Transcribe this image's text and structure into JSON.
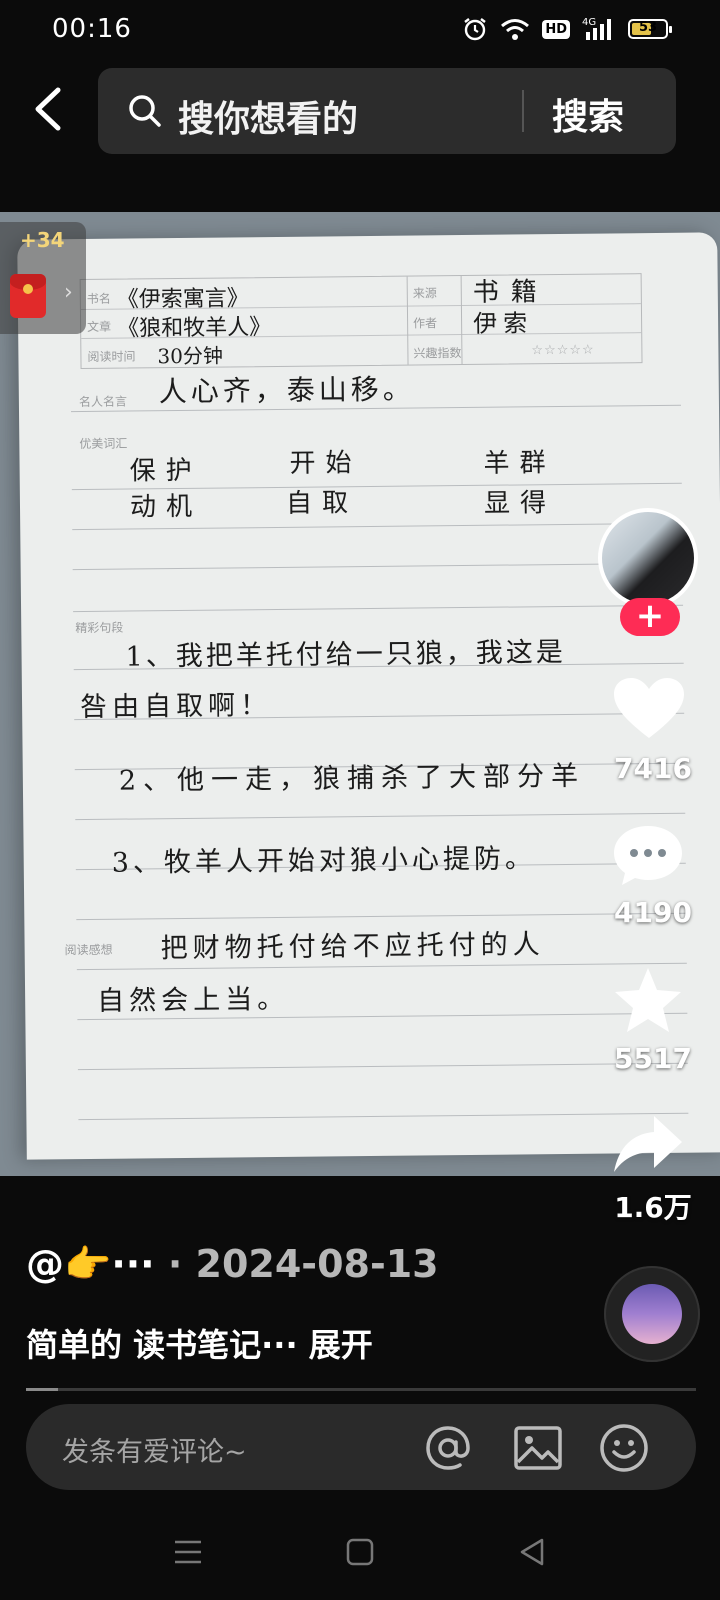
{
  "status_bar": {
    "time": "00:16",
    "network": "4G",
    "hd": "HD",
    "battery": "53"
  },
  "search": {
    "placeholder": "搜你想看的",
    "button": "搜索"
  },
  "red_packet": {
    "reward": "+34"
  },
  "note": {
    "labels": {
      "book_name": "书名",
      "article": "文章",
      "reading_time": "阅读时间",
      "source": "来源",
      "author": "作者",
      "interest": "兴趣指数",
      "quote": "名人名言",
      "words": "优美词汇",
      "sentences": "精彩句段",
      "thoughts": "阅读感想"
    },
    "book_name": "《伊索寓言》",
    "article": "《狼和牧羊人》",
    "reading_time": "30分钟",
    "source": "书籍",
    "author": "伊索",
    "stars": "☆☆☆☆☆",
    "quote": "人心齐，泰山移。",
    "words": [
      "保护",
      "开始",
      "羊群",
      "动机",
      "自取",
      "显得"
    ],
    "sentence_1a": "1、我把羊托付给一只狼，我这是",
    "sentence_1b": "咎由自取啊！",
    "sentence_2": "2、他一走，狼捕杀了大部分羊",
    "sentence_3": "3、牧羊人开始对狼小心提防。",
    "thought_a": "把财物托付给不应托付的人",
    "thought_b": "自然会上当。"
  },
  "side": {
    "likes": "7416",
    "comments": "4190",
    "favorites": "5517",
    "shares": "1.6万"
  },
  "post": {
    "author": "@👉···",
    "separator": " · ",
    "date": "2024-08-13",
    "description": "简单的 读书笔记··· 展开"
  },
  "comment": {
    "placeholder": "发条有爱评论~"
  },
  "colors": {
    "follow": "#fe2c55",
    "background": "#0b0b0b"
  }
}
